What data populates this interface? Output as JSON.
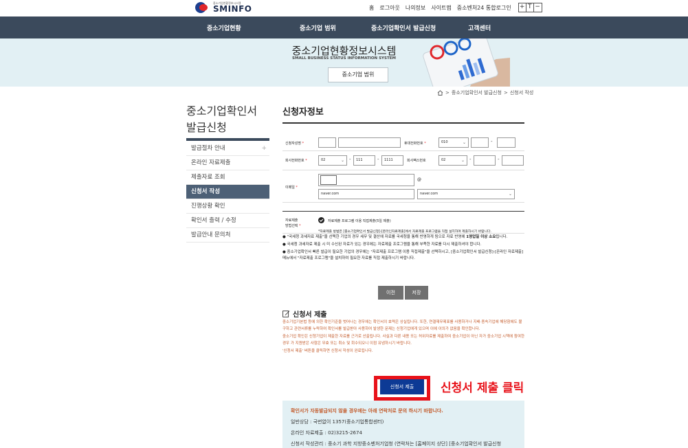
{
  "header": {
    "logo_small": "중소기업현황정보시스템",
    "logo_big": "SMINFO",
    "util_links": [
      "홈",
      "로그아웃",
      "나의정보",
      "사이트맵",
      "중소벤처24 통합로그인"
    ],
    "font_buttons": [
      "+",
      "T",
      "−"
    ]
  },
  "nav": {
    "items": [
      "중소기업현황",
      "중소기업 범위",
      "중소기업확인서 발급신청",
      "고객센터"
    ]
  },
  "banner": {
    "title": "중소기업현황정보시스템",
    "subtitle": "SMALL BUSINESS STATUS INFORMATION SYSTEM",
    "button": "중소기업 범위"
  },
  "breadcrumb": {
    "items": [
      "중소기업확인서 발급신청",
      "신청서 작성"
    ],
    "separator": ">"
  },
  "sidebar": {
    "title_line1": "중소기업확인서",
    "title_line2": "발급신청",
    "plus": "+",
    "items": [
      {
        "label": "발급절차 안내"
      },
      {
        "label": "온라인 자료제출"
      },
      {
        "label": "제출자료 조회"
      },
      {
        "label": "신청서 작성"
      },
      {
        "label": "진행상황 확인"
      },
      {
        "label": "확인서 출력 / 수정"
      },
      {
        "label": "발급안내 문의처"
      }
    ],
    "active_index": 3
  },
  "form": {
    "title": "신청자정보",
    "required_mark": "*",
    "labels": {
      "name": "신청자성명",
      "mobile": "휴대전화번호",
      "office_phone": "회사전화번호",
      "fax": "회사팩스번호",
      "email": "이메일",
      "submit_method_1": "자료제출",
      "submit_method_2": "방법선택"
    },
    "values": {
      "mobile_prefix": "010",
      "office_area": "02",
      "office_mid": "111",
      "office_last": "1111",
      "fax_area": "02",
      "email_at": "@",
      "email_domain_input": "naver.com",
      "email_domain_select": "naver.com"
    },
    "submit_option": "자료제출 프로그램 이용 직접제출(5일 제출)",
    "submit_option_desc": "*자료제출 방법은 [중소기업확인서 발급신청]-[온라인자료제출]에서 자료제출 프로그램을 직접 설치하여 제출하시기 바랍니다."
  },
  "notes": {
    "n1_pre": "● \"국세청 과세자료 제출\"을 선택한 기업의 경우 세무 및 결산에 자료를 국세청을 통해 반영하게 됨으로 자료 반영에 ",
    "n1_bold": "1영업일 이상 소요",
    "n1_post": "됩니다.",
    "n2": "● 국세청 과세자료 제출 시 미 수신된 자료가 있는 경우에는 자료제출 프로그램을 통해 부족한 자료를 다시 제출하셔야 합니다.",
    "n3": "● 중소기업확인서 빠른 발급이 필요한 기업의 경우에는 \"자료제출 프로그램 이용 직접제출\"을 선택하시고, [중소기업확인서 발급신청]-[온라인 자료제출] 메뉴에서 \"자료제출 프로그램\"을 설치하여 필요한 자료를 직접 제출하시기 바랍니다."
  },
  "buttons": {
    "prev": "이전",
    "save": "저장",
    "submit": "신청서 제출"
  },
  "submission": {
    "title": "신청서 제출",
    "p1": "중소기업기본법 등에 의한 확인기준을 벗어나는 경우에는 확인서의 효력은 상실됩니다. 또한, 연결재무제표를 사용하거나 지배·종속기업에 해당함에도 불구하고 관련서류를 누락하여 확인서를 발급받아 사용하여 발생한 문제는 신청기업에게 있으며 이에 이의가 없음을 확인합니다.",
    "p2": "중소기업 확인은 신청기업이 제출한 자료를 근거로 산출됩니다. 사실과 다른 내용 또는 허위자료를 제출하여 중소기업이 아닌 자가 중소기업 시책에 참여한 경우 가 지원받은 사항은 무효 또는 취소 및 회수되오니 이점 유념하시기 바랍니다.",
    "p3": "'신청서 제출' 버튼을 클릭하면 신청서 작성이 완료됩니다."
  },
  "annotation": "신청서 제출 클릭",
  "contact": {
    "lead": "확인서가 자동발급되지 않을 경우에는 아래 연락처로 문의 하시기 바랍니다.",
    "line1": "일반상담 : 국번없이 1357(중소기업통합센터)",
    "line2": "온라인 자료제출 : 02)3215-2674",
    "line3": "신청서 작성관리 : 중소기 과학 지방중소벤처기업청 (연락처는 [홈페이지 상단] [중소기업확인서 발급신청"
  },
  "colors": {
    "nav_bg": "#3b4a5c",
    "banner_bg": "#e2f0f4",
    "submit_blue": "#0d3a95",
    "highlight_red": "#e8121a",
    "note_orange": "#c35a2a"
  }
}
